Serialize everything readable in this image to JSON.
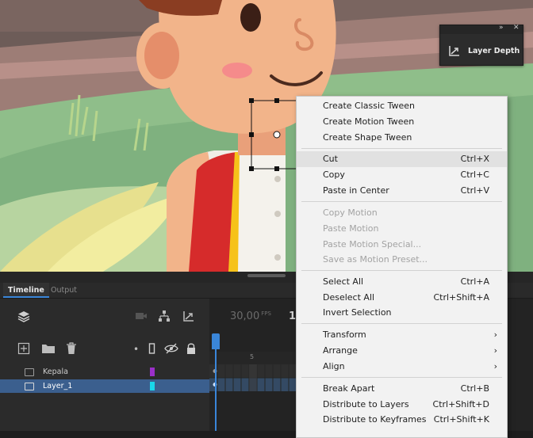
{
  "layer_depth_panel": {
    "title": "Layer Depth",
    "expand_glyph": "»",
    "close_glyph": "✕"
  },
  "timeline": {
    "tabs": [
      "Timeline",
      "Output"
    ],
    "fps_value": "30,00",
    "fps_unit": "FPS",
    "current_frame_partial": "1",
    "ruler_marker": "5",
    "layers": [
      {
        "name": "Kepala",
        "color": "#9b30c9",
        "selected": false
      },
      {
        "name": "Layer_1",
        "color": "#19d6ea",
        "selected": true
      }
    ]
  },
  "context_menu": {
    "groups": [
      [
        {
          "label": "Create Classic Tween",
          "shortcut": "",
          "enabled": true
        },
        {
          "label": "Create Motion Tween",
          "shortcut": "",
          "enabled": true
        },
        {
          "label": "Create Shape Tween",
          "shortcut": "",
          "enabled": true
        }
      ],
      [
        {
          "label": "Cut",
          "shortcut": "Ctrl+X",
          "enabled": true,
          "highlighted": true
        },
        {
          "label": "Copy",
          "shortcut": "Ctrl+C",
          "enabled": true
        },
        {
          "label": "Paste in Center",
          "shortcut": "Ctrl+V",
          "enabled": true
        }
      ],
      [
        {
          "label": "Copy Motion",
          "shortcut": "",
          "enabled": false
        },
        {
          "label": "Paste Motion",
          "shortcut": "",
          "enabled": false
        },
        {
          "label": "Paste Motion Special...",
          "shortcut": "",
          "enabled": false
        },
        {
          "label": "Save as Motion Preset...",
          "shortcut": "",
          "enabled": false
        }
      ],
      [
        {
          "label": "Select All",
          "shortcut": "Ctrl+A",
          "enabled": true
        },
        {
          "label": "Deselect All",
          "shortcut": "Ctrl+Shift+A",
          "enabled": true
        },
        {
          "label": "Invert Selection",
          "shortcut": "",
          "enabled": true
        }
      ],
      [
        {
          "label": "Transform",
          "submenu": true,
          "enabled": true
        },
        {
          "label": "Arrange",
          "submenu": true,
          "enabled": true
        },
        {
          "label": "Align",
          "submenu": true,
          "enabled": true
        }
      ],
      [
        {
          "label": "Break Apart",
          "shortcut": "Ctrl+B",
          "enabled": true
        },
        {
          "label": "Distribute to Layers",
          "shortcut": "Ctrl+Shift+D",
          "enabled": true
        },
        {
          "label": "Distribute to Keyframes",
          "shortcut": "Ctrl+Shift+K",
          "enabled": true
        }
      ]
    ]
  }
}
